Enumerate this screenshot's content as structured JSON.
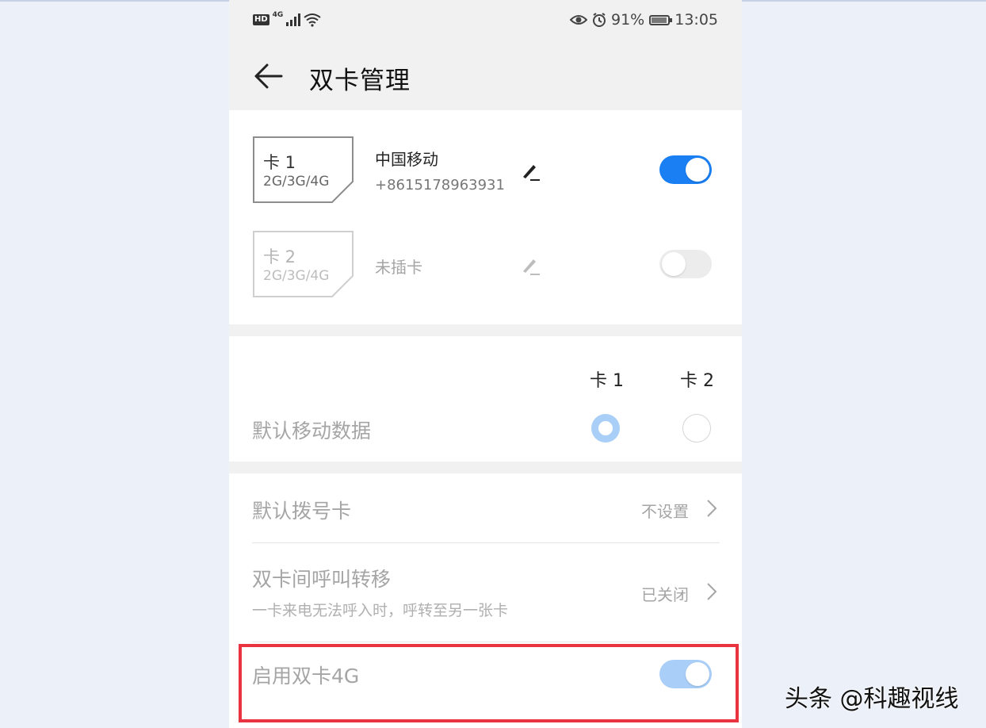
{
  "status": {
    "hd": "HD",
    "network": "4G",
    "battery": "91%",
    "time": "13:05"
  },
  "header": {
    "title": "双卡管理"
  },
  "sims": [
    {
      "label": "卡 1",
      "bands": "2G/3G/4G",
      "carrier": "中国移动",
      "number": "+8615178963931",
      "enabled": true
    },
    {
      "label": "卡 2",
      "bands": "2G/3G/4G",
      "carrier": "未插卡",
      "enabled": false
    }
  ],
  "default_data": {
    "col1": "卡 1",
    "col2": "卡 2",
    "label": "默认移动数据",
    "selected": "卡 1"
  },
  "settings": {
    "dial_label": "默认拨号卡",
    "dial_value": "不设置",
    "forward_label": "双卡间呼叫转移",
    "forward_sub": "一卡来电无法呼入时，呼转至另一张卡",
    "forward_value": "已关闭",
    "dual4g_label": "启用双卡4G",
    "dual4g_on": true
  },
  "watermark": "头条 @科趣视线",
  "colors": {
    "accent": "#1a7ff2",
    "accent_light": "#a9cff8",
    "highlight": "#e93340",
    "toggle_off": "#ececec"
  }
}
